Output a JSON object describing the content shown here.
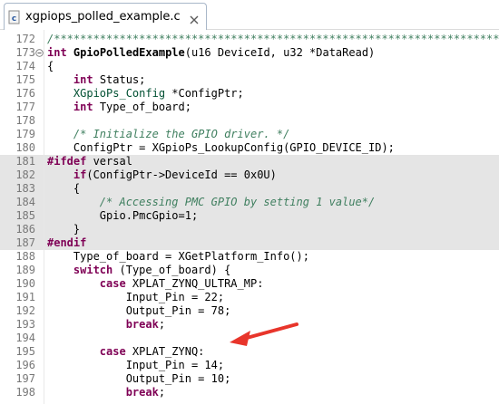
{
  "tab": {
    "title": "xgpiops_polled_example.c",
    "icon": "c-file-icon",
    "close_icon": "close-x-icon"
  },
  "colors": {
    "keyword": "#7f0055",
    "comment": "#3f7f5f",
    "type": "#005032",
    "line_number": "#787878",
    "highlight": "#e5e5e5",
    "arrow": "#e8352b"
  },
  "lines": [
    {
      "num": "172",
      "tokens": [
        {
          "t": "/*****************************************************************************",
          "c": "cm"
        }
      ]
    },
    {
      "num": "173",
      "fold": true,
      "tokens": [
        {
          "t": "int",
          "c": "kw"
        },
        {
          "t": " "
        },
        {
          "t": "GpioPolledExample",
          "c": "fn"
        },
        {
          "t": "(u16 DeviceId, u32 *DataRead)"
        }
      ]
    },
    {
      "num": "174",
      "tokens": [
        {
          "t": "{"
        }
      ]
    },
    {
      "num": "175",
      "tokens": [
        {
          "t": "    "
        },
        {
          "t": "int",
          "c": "kw"
        },
        {
          "t": " Status;"
        }
      ]
    },
    {
      "num": "176",
      "tokens": [
        {
          "t": "    "
        },
        {
          "t": "XGpioPs_Config",
          "c": "ty"
        },
        {
          "t": " *ConfigPtr;"
        }
      ]
    },
    {
      "num": "177",
      "tokens": [
        {
          "t": "    "
        },
        {
          "t": "int",
          "c": "kw"
        },
        {
          "t": " Type_of_board;"
        }
      ]
    },
    {
      "num": "178",
      "tokens": [
        {
          "t": ""
        }
      ]
    },
    {
      "num": "179",
      "tokens": [
        {
          "t": "    "
        },
        {
          "t": "/* Initialize the GPIO driver. */",
          "c": "cm"
        }
      ]
    },
    {
      "num": "180",
      "tokens": [
        {
          "t": "    ConfigPtr = XGpioPs_LookupConfig(GPIO_DEVICE_ID);"
        }
      ]
    },
    {
      "num": "181",
      "hl": true,
      "tokens": [
        {
          "t": "#ifdef",
          "c": "kw"
        },
        {
          "t": " versal"
        }
      ]
    },
    {
      "num": "182",
      "hl": true,
      "tokens": [
        {
          "t": "    "
        },
        {
          "t": "if",
          "c": "kw"
        },
        {
          "t": "(ConfigPtr->DeviceId == 0x0U)"
        }
      ]
    },
    {
      "num": "183",
      "hl": true,
      "tokens": [
        {
          "t": "    {"
        }
      ]
    },
    {
      "num": "184",
      "hl": true,
      "tokens": [
        {
          "t": "        "
        },
        {
          "t": "/* Accessing PMC GPIO by setting 1 value*/",
          "c": "cm"
        }
      ]
    },
    {
      "num": "185",
      "hl": true,
      "tokens": [
        {
          "t": "        Gpio.PmcGpio=1;"
        }
      ]
    },
    {
      "num": "186",
      "hl": true,
      "tokens": [
        {
          "t": "    }"
        }
      ]
    },
    {
      "num": "187",
      "hl": true,
      "tokens": [
        {
          "t": "#endif",
          "c": "kw"
        }
      ]
    },
    {
      "num": "188",
      "tokens": [
        {
          "t": "    Type_of_board = XGetPlatform_Info();"
        }
      ]
    },
    {
      "num": "189",
      "tokens": [
        {
          "t": "    "
        },
        {
          "t": "switch",
          "c": "kw"
        },
        {
          "t": " (Type_of_board) {"
        }
      ]
    },
    {
      "num": "190",
      "tokens": [
        {
          "t": "        "
        },
        {
          "t": "case",
          "c": "kw"
        },
        {
          "t": " XPLAT_ZYNQ_ULTRA_MP:"
        }
      ]
    },
    {
      "num": "191",
      "tokens": [
        {
          "t": "            Input_Pin = 22;"
        }
      ]
    },
    {
      "num": "192",
      "tokens": [
        {
          "t": "            Output_Pin = 78;"
        }
      ]
    },
    {
      "num": "193",
      "tokens": [
        {
          "t": "            "
        },
        {
          "t": "break",
          "c": "kw"
        },
        {
          "t": ";"
        }
      ]
    },
    {
      "num": "194",
      "tokens": [
        {
          "t": ""
        }
      ]
    },
    {
      "num": "195",
      "tokens": [
        {
          "t": "        "
        },
        {
          "t": "case",
          "c": "kw"
        },
        {
          "t": " XPLAT_ZYNQ:"
        }
      ]
    },
    {
      "num": "196",
      "tokens": [
        {
          "t": "            Input_Pin = 14;"
        }
      ]
    },
    {
      "num": "197",
      "tokens": [
        {
          "t": "            Output_Pin = 10;"
        }
      ]
    },
    {
      "num": "198",
      "tokens": [
        {
          "t": "            "
        },
        {
          "t": "break",
          "c": "kw"
        },
        {
          "t": ";"
        }
      ]
    }
  ]
}
